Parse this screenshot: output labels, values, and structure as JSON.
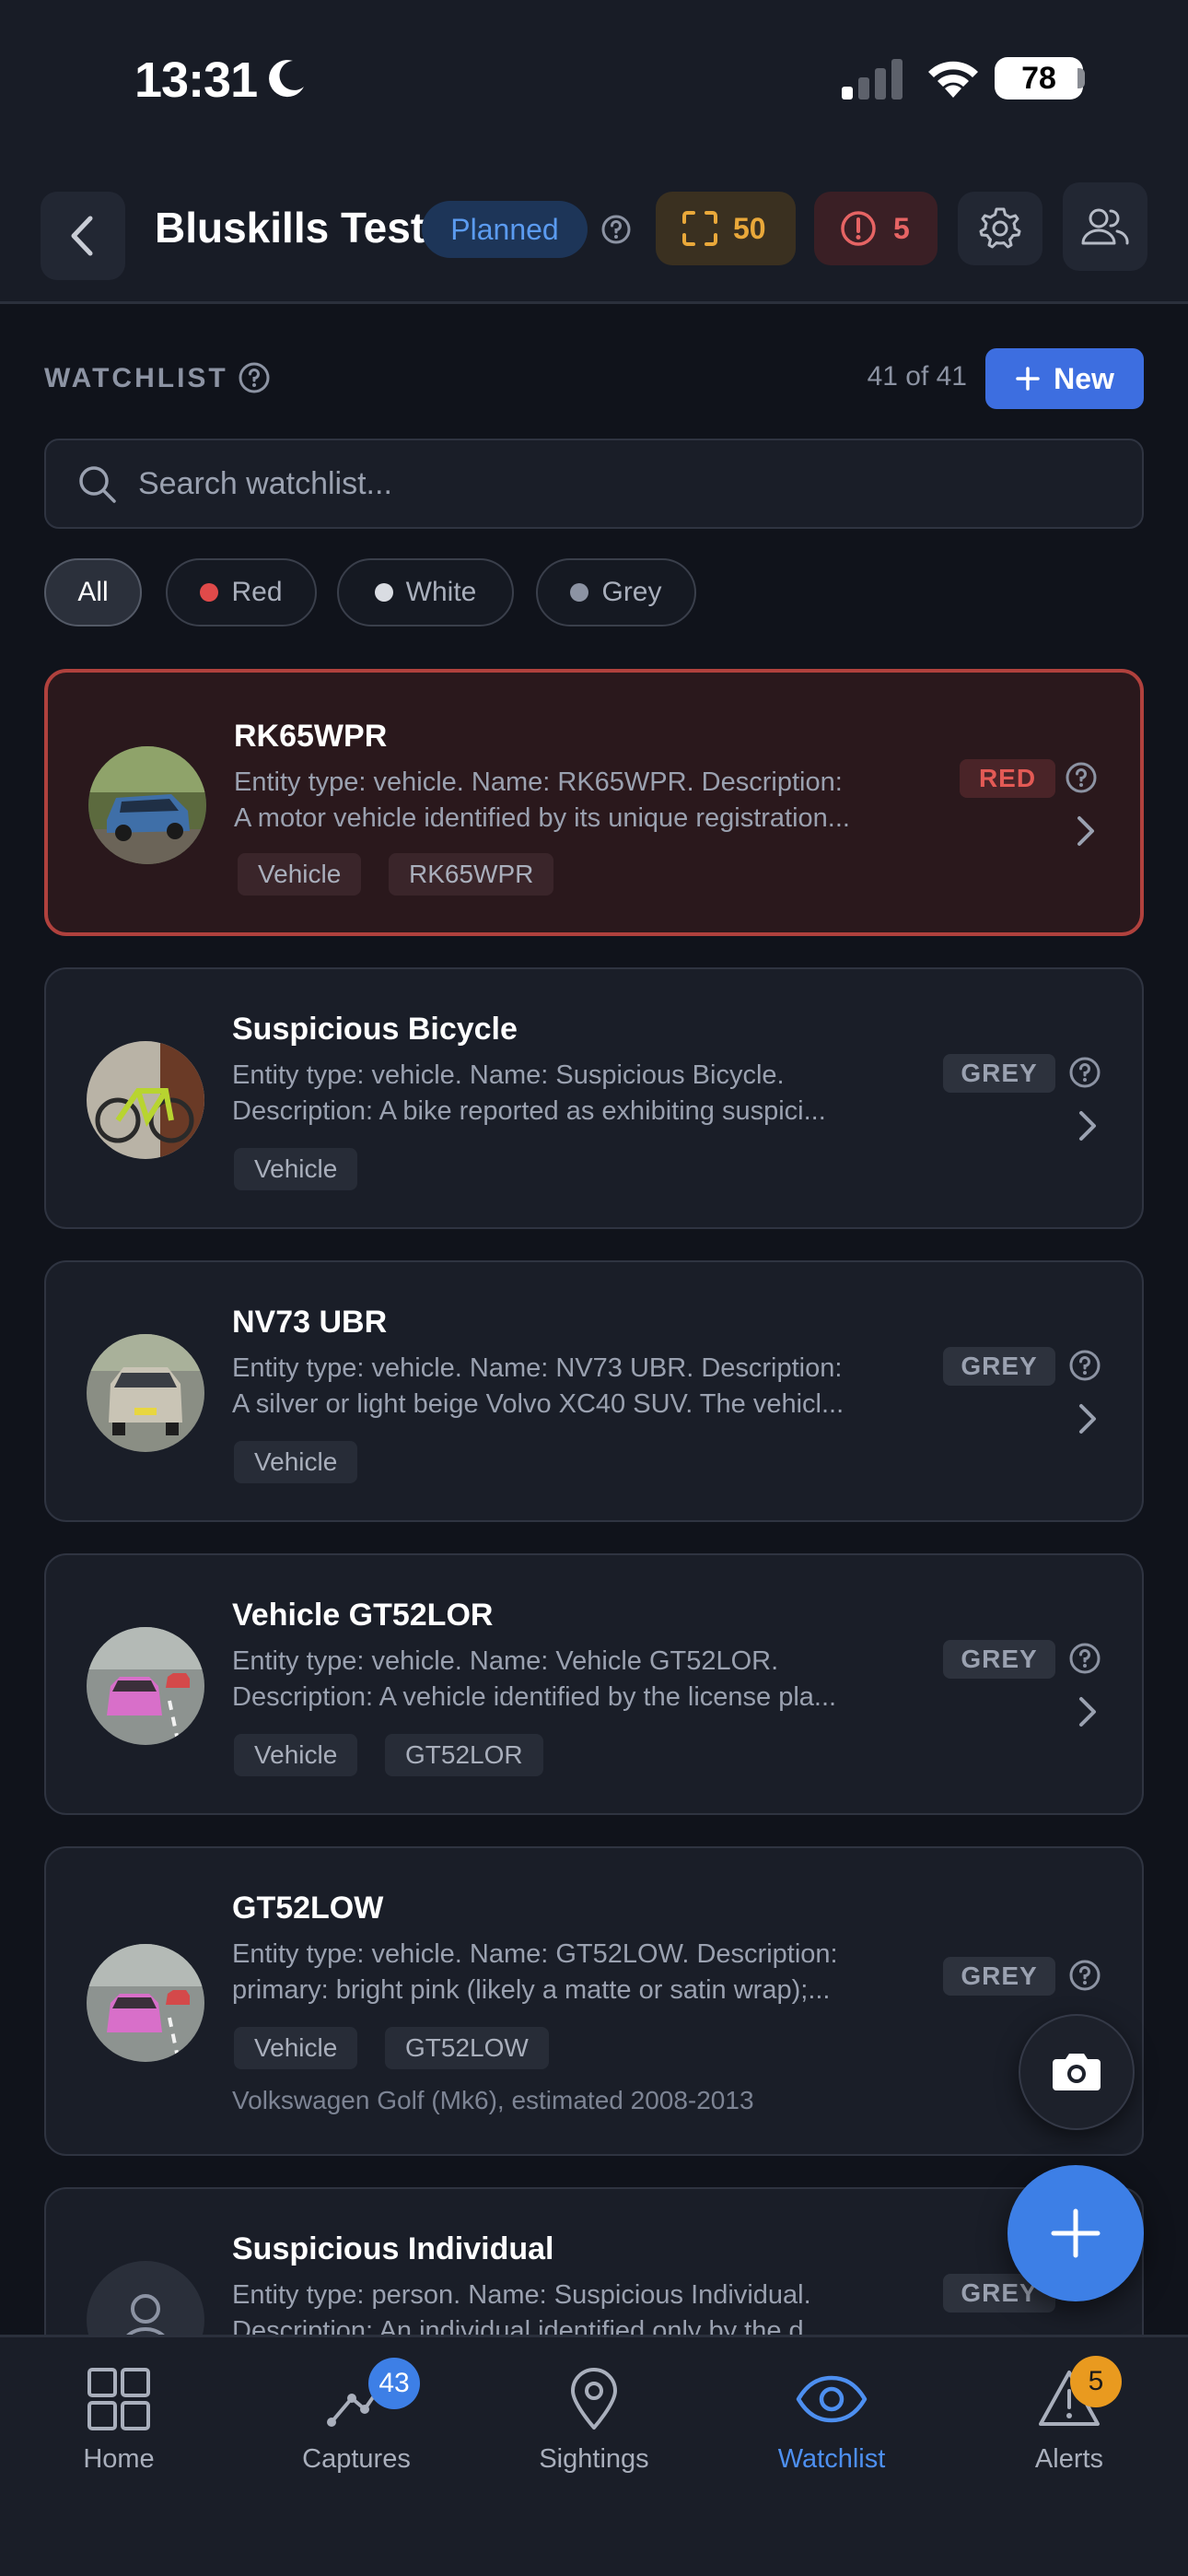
{
  "status_bar": {
    "time": "13:31",
    "battery": "78"
  },
  "header": {
    "title": "Bluskills Test",
    "status_badge": "Planned",
    "captures_count": "50",
    "alerts_count": "5"
  },
  "watchlist": {
    "section_label": "WATCHLIST",
    "count_text": "41 of 41",
    "new_button_label": "New",
    "search_placeholder": "Search watchlist...",
    "filters": [
      {
        "label": "All",
        "color": ""
      },
      {
        "label": "Red",
        "color": "#e04a4a"
      },
      {
        "label": "White",
        "color": "#d9dce2"
      },
      {
        "label": "Grey",
        "color": "#8c93a3"
      }
    ],
    "items": [
      {
        "title": "RK65WPR",
        "desc_line1": "Entity type: vehicle. Name: RK65WPR. Description:",
        "desc_line2": "A motor vehicle identified by its unique registration...",
        "level": "RED",
        "tags": [
          "Vehicle",
          "RK65WPR"
        ],
        "image": "blue hatchback car"
      },
      {
        "title": "Suspicious Bicycle",
        "desc_line1": "Entity type: vehicle. Name: Suspicious Bicycle.",
        "desc_line2": "Description: A bike reported as exhibiting suspici...",
        "level": "GREY",
        "tags": [
          "Vehicle"
        ],
        "image": "lime green bicycle"
      },
      {
        "title": "NV73 UBR",
        "desc_line1": "Entity type: vehicle. Name: NV73 UBR. Description:",
        "desc_line2": "A silver or light beige Volvo XC40 SUV. The vehicl...",
        "level": "GREY",
        "tags": [
          "Vehicle"
        ],
        "image": "silver SUV rear"
      },
      {
        "title": "Vehicle GT52LOR",
        "desc_line1": "Entity type: vehicle. Name: Vehicle GT52LOR.",
        "desc_line2": "Description: A vehicle identified by the license pla...",
        "level": "GREY",
        "tags": [
          "Vehicle",
          "GT52LOR"
        ],
        "image": "pink car on road"
      },
      {
        "title": "GT52LOW",
        "desc_line1": "Entity type: vehicle. Name: GT52LOW. Description:",
        "desc_line2": "primary: bright pink (likely a matte or satin wrap);...",
        "level": "GREY",
        "tags": [
          "Vehicle",
          "GT52LOW"
        ],
        "meta": "Volkswagen Golf (Mk6), estimated 2008-2013",
        "image": "pink car on road"
      },
      {
        "title": "Suspicious Individual",
        "desc_line1": "Entity type: person. Name: Suspicious Individual.",
        "desc_line2": "Description: An individual identified only by the d...",
        "level": "GREY",
        "tags": [],
        "image": "person placeholder icon"
      }
    ]
  },
  "bottom_nav": {
    "items": [
      {
        "label": "Home",
        "icon": "grid-icon"
      },
      {
        "label": "Captures",
        "icon": "captures-icon",
        "badge": "43"
      },
      {
        "label": "Sightings",
        "icon": "map-pin-icon"
      },
      {
        "label": "Watchlist",
        "icon": "eye-icon",
        "active": true
      },
      {
        "label": "Alerts",
        "icon": "warning-icon",
        "badge": "5"
      }
    ]
  },
  "colors": {
    "background": "#10131b",
    "surface": "#1a1e28",
    "accent": "#3d6ee0",
    "red": "#e35a55",
    "amber": "#e9a83a",
    "active_nav": "#4d8ff0"
  }
}
